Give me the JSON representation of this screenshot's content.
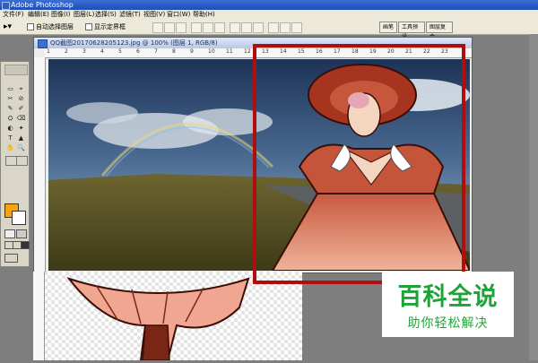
{
  "app": {
    "title": "Adobe Photoshop"
  },
  "menu": [
    "文件(F)",
    "编辑(E)",
    "图像(I)",
    "图层(L)",
    "选择(S)",
    "滤镜(T)",
    "视图(V)",
    "窗口(W)",
    "帮助(H)"
  ],
  "options": {
    "auto_select_label": "自动选择图层",
    "show_bounds_label": "显示定界框"
  },
  "palette_well": [
    "画笔",
    "工具预设",
    "图层复合"
  ],
  "document": {
    "title": "QQ截图20170628205123.jpg @ 100% (图层 1, RGB/8)",
    "ruler_ticks": [
      "1",
      "2",
      "3",
      "4",
      "5",
      "6",
      "7",
      "8",
      "9",
      "10",
      "11",
      "12",
      "13",
      "14",
      "15",
      "16",
      "17",
      "18",
      "19",
      "20",
      "21",
      "22",
      "23"
    ]
  },
  "toolbox": {
    "tools": [
      "▭",
      "⌖",
      "✂",
      "⊘",
      "✎",
      "✐",
      "⛭",
      "⌫",
      "◐",
      "✦",
      "T",
      "▲",
      "✋",
      "🔍"
    ],
    "foreground_color": "#f3a410",
    "background_color": "#ffffff"
  },
  "watermark": {
    "line1": "百科全说",
    "line2": "助你轻松解决"
  },
  "colors": {
    "highlight_border": "#b00d0d",
    "watermark_green": "#1ea33a"
  }
}
